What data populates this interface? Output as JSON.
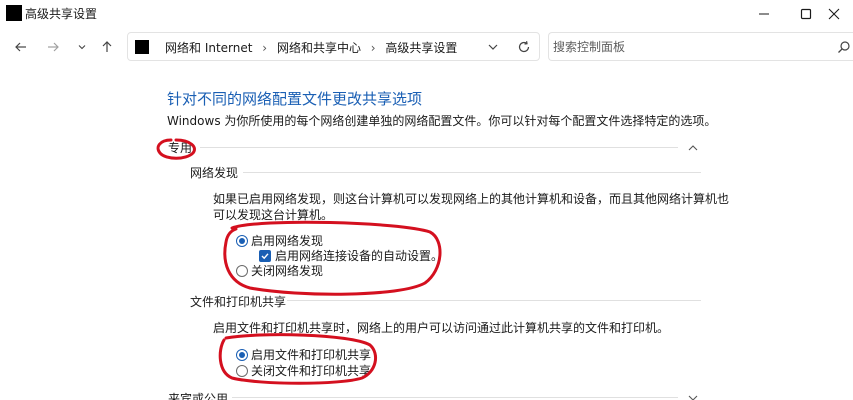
{
  "window": {
    "title": "高级共享设置"
  },
  "navigation": {
    "breadcrumbs": [
      "网络和 Internet",
      "网络和共享中心",
      "高级共享设置"
    ],
    "search_placeholder": "搜索控制面板"
  },
  "page": {
    "heading": "针对不同的网络配置文件更改共享选项",
    "description": "Windows 为你所使用的每个网络创建单独的网络配置文件。你可以针对每个配置文件选择特定的选项。"
  },
  "profiles": {
    "private": {
      "label": "专用",
      "network_discovery": {
        "title": "网络发现",
        "description_line1": "如果已启用网络发现，则这台计算机可以发现网络上的其他计算机和设备，而且其他网络计算机也",
        "description_line2": "可以发现这台计算机。",
        "option_on": "启用网络发现",
        "option_auto": "启用网络连接设备的自动设置。",
        "option_off": "关闭网络发现",
        "selected": "on",
        "auto_checked": true
      },
      "file_printer_sharing": {
        "title": "文件和打印机共享",
        "description": "启用文件和打印机共享时，网络上的用户可以访问通过此计算机共享的文件和打印机。",
        "option_on": "启用文件和打印机共享",
        "option_off": "关闭文件和打印机共享",
        "selected": "on"
      }
    },
    "guest_public": {
      "label": "来宾或公用"
    }
  },
  "colors": {
    "accent": "#1a5fb4",
    "annotation": "#d4101f"
  }
}
